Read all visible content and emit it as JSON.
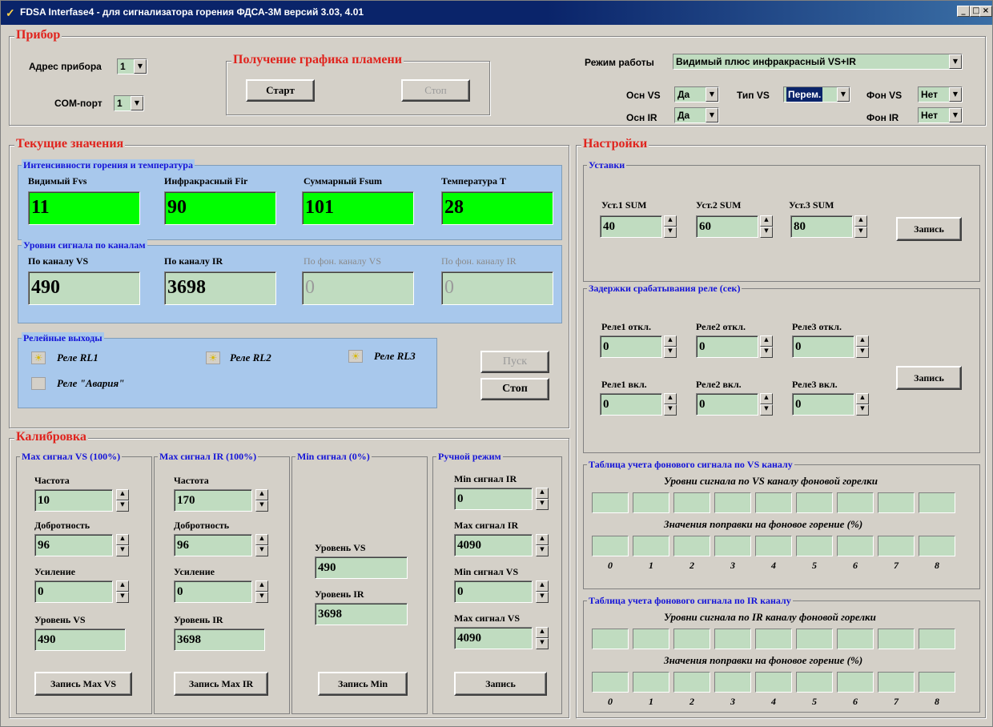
{
  "window": {
    "title": "FDSA Interfase4 - для сигнализатора горения ФДСА-3М версий 3.03, 4.01",
    "minimize": "_",
    "maximize": "□",
    "close": "×"
  },
  "device": {
    "title": "Прибор",
    "address_label": "Адрес прибора",
    "address_value": "1",
    "com_label": "COM-порт",
    "com_value": "1",
    "flame": {
      "title": "Получение графика пламени",
      "start": "Старт",
      "stop": "Стоп"
    },
    "mode_label": "Режим работы",
    "mode_value": "Видимый плюс инфракрасный VS+IR",
    "osn_vs_label": "Осн VS",
    "osn_vs_value": "Да",
    "tip_vs_label": "Тип VS",
    "tip_vs_value": "Перем.",
    "fon_vs_label": "Фон VS",
    "fon_vs_value": "Нет",
    "osn_ir_label": "Осн IR",
    "osn_ir_value": "Да",
    "fon_ir_label": "Фон IR",
    "fon_ir_value": "Нет"
  },
  "current": {
    "title": "Текущие значения",
    "intensity": {
      "title": "Интенсивности горения и температура",
      "items": [
        {
          "label": "Видимый Fvs",
          "value": "11"
        },
        {
          "label": "Инфракрасный Fir",
          "value": "90"
        },
        {
          "label": "Суммарный Fsum",
          "value": "101"
        },
        {
          "label": "Температура T",
          "value": "28"
        }
      ]
    },
    "levels": {
      "title": "Уровни сигнала по каналам",
      "items": [
        {
          "label": "По каналу VS",
          "value": "490"
        },
        {
          "label": "По каналу IR",
          "value": "3698"
        },
        {
          "label": "По фон. каналу VS",
          "value": "0"
        },
        {
          "label": "По фон. каналу IR",
          "value": "0"
        }
      ]
    },
    "relays": {
      "title": "Релейные выходы",
      "rl1": "Реле RL1",
      "rl2": "Реле RL2",
      "rl3": "Реле RL3",
      "alarm": "Реле \"Авария\""
    },
    "start": "Пуск",
    "stop": "Стоп"
  },
  "calibration": {
    "title": "Калибровка",
    "vs": {
      "title": "Max сигнал VS (100%)",
      "freq_label": "Частота",
      "freq": "10",
      "q_label": "Добротность",
      "q": "96",
      "gain_label": "Усиление",
      "gain": "0",
      "level_label": "Уровень VS",
      "level": "490",
      "write": "Запись Max VS"
    },
    "ir": {
      "title": "Max сигнал IR (100%)",
      "freq_label": "Частота",
      "freq": "170",
      "q_label": "Добротность",
      "q": "96",
      "gain_label": "Усиление",
      "gain": "0",
      "level_label": "Уровень IR",
      "level": "3698",
      "write": "Запись Max IR"
    },
    "min": {
      "title": "Min сигнал (0%)",
      "vs_label": "Уровень VS",
      "vs": "490",
      "ir_label": "Уровень IR",
      "ir": "3698",
      "write": "Запись Min"
    },
    "manual": {
      "title": "Ручной режим",
      "min_ir_label": "Min сигнал IR",
      "min_ir": "0",
      "max_ir_label": "Max сигнал IR",
      "max_ir": "4090",
      "min_vs_label": "Min сигнал VS",
      "min_vs": "0",
      "max_vs_label": "Max сигнал VS",
      "max_vs": "4090",
      "write": "Запись"
    }
  },
  "settings": {
    "title": "Настройки",
    "setpoints": {
      "title": "Уставки",
      "s1_label": "Уст.1 SUM",
      "s1": "40",
      "s2_label": "Уст.2 SUM",
      "s2": "60",
      "s3_label": "Уст.3 SUM",
      "s3": "80",
      "write": "Запись"
    },
    "delays": {
      "title": "Задержки срабатывания реле (сек)",
      "r1off_label": "Реле1 откл.",
      "r1off": "0",
      "r2off_label": "Реле2 откл.",
      "r2off": "0",
      "r3off_label": "Реле3 откл.",
      "r3off": "0",
      "r1on_label": "Реле1 вкл.",
      "r1on": "0",
      "r2on_label": "Реле2 вкл.",
      "r2on": "0",
      "r3on_label": "Реле3 вкл.",
      "r3on": "0",
      "write": "Запись"
    },
    "vs_table": {
      "title": "Таблица учета фонового сигнала по VS каналу",
      "row1": "Уровни сигнала по VS каналу фоновой горелки",
      "row2": "Значения поправки на фоновое горение (%)",
      "indices": [
        "0",
        "1",
        "2",
        "3",
        "4",
        "5",
        "6",
        "7",
        "8"
      ]
    },
    "ir_table": {
      "title": "Таблица учета фонового сигнала по IR каналу",
      "row1": "Уровни сигнала по IR каналу фоновой горелки",
      "row2": "Значения поправки на фоновое горение (%)",
      "indices": [
        "0",
        "1",
        "2",
        "3",
        "4",
        "5",
        "6",
        "7",
        "8"
      ]
    }
  }
}
